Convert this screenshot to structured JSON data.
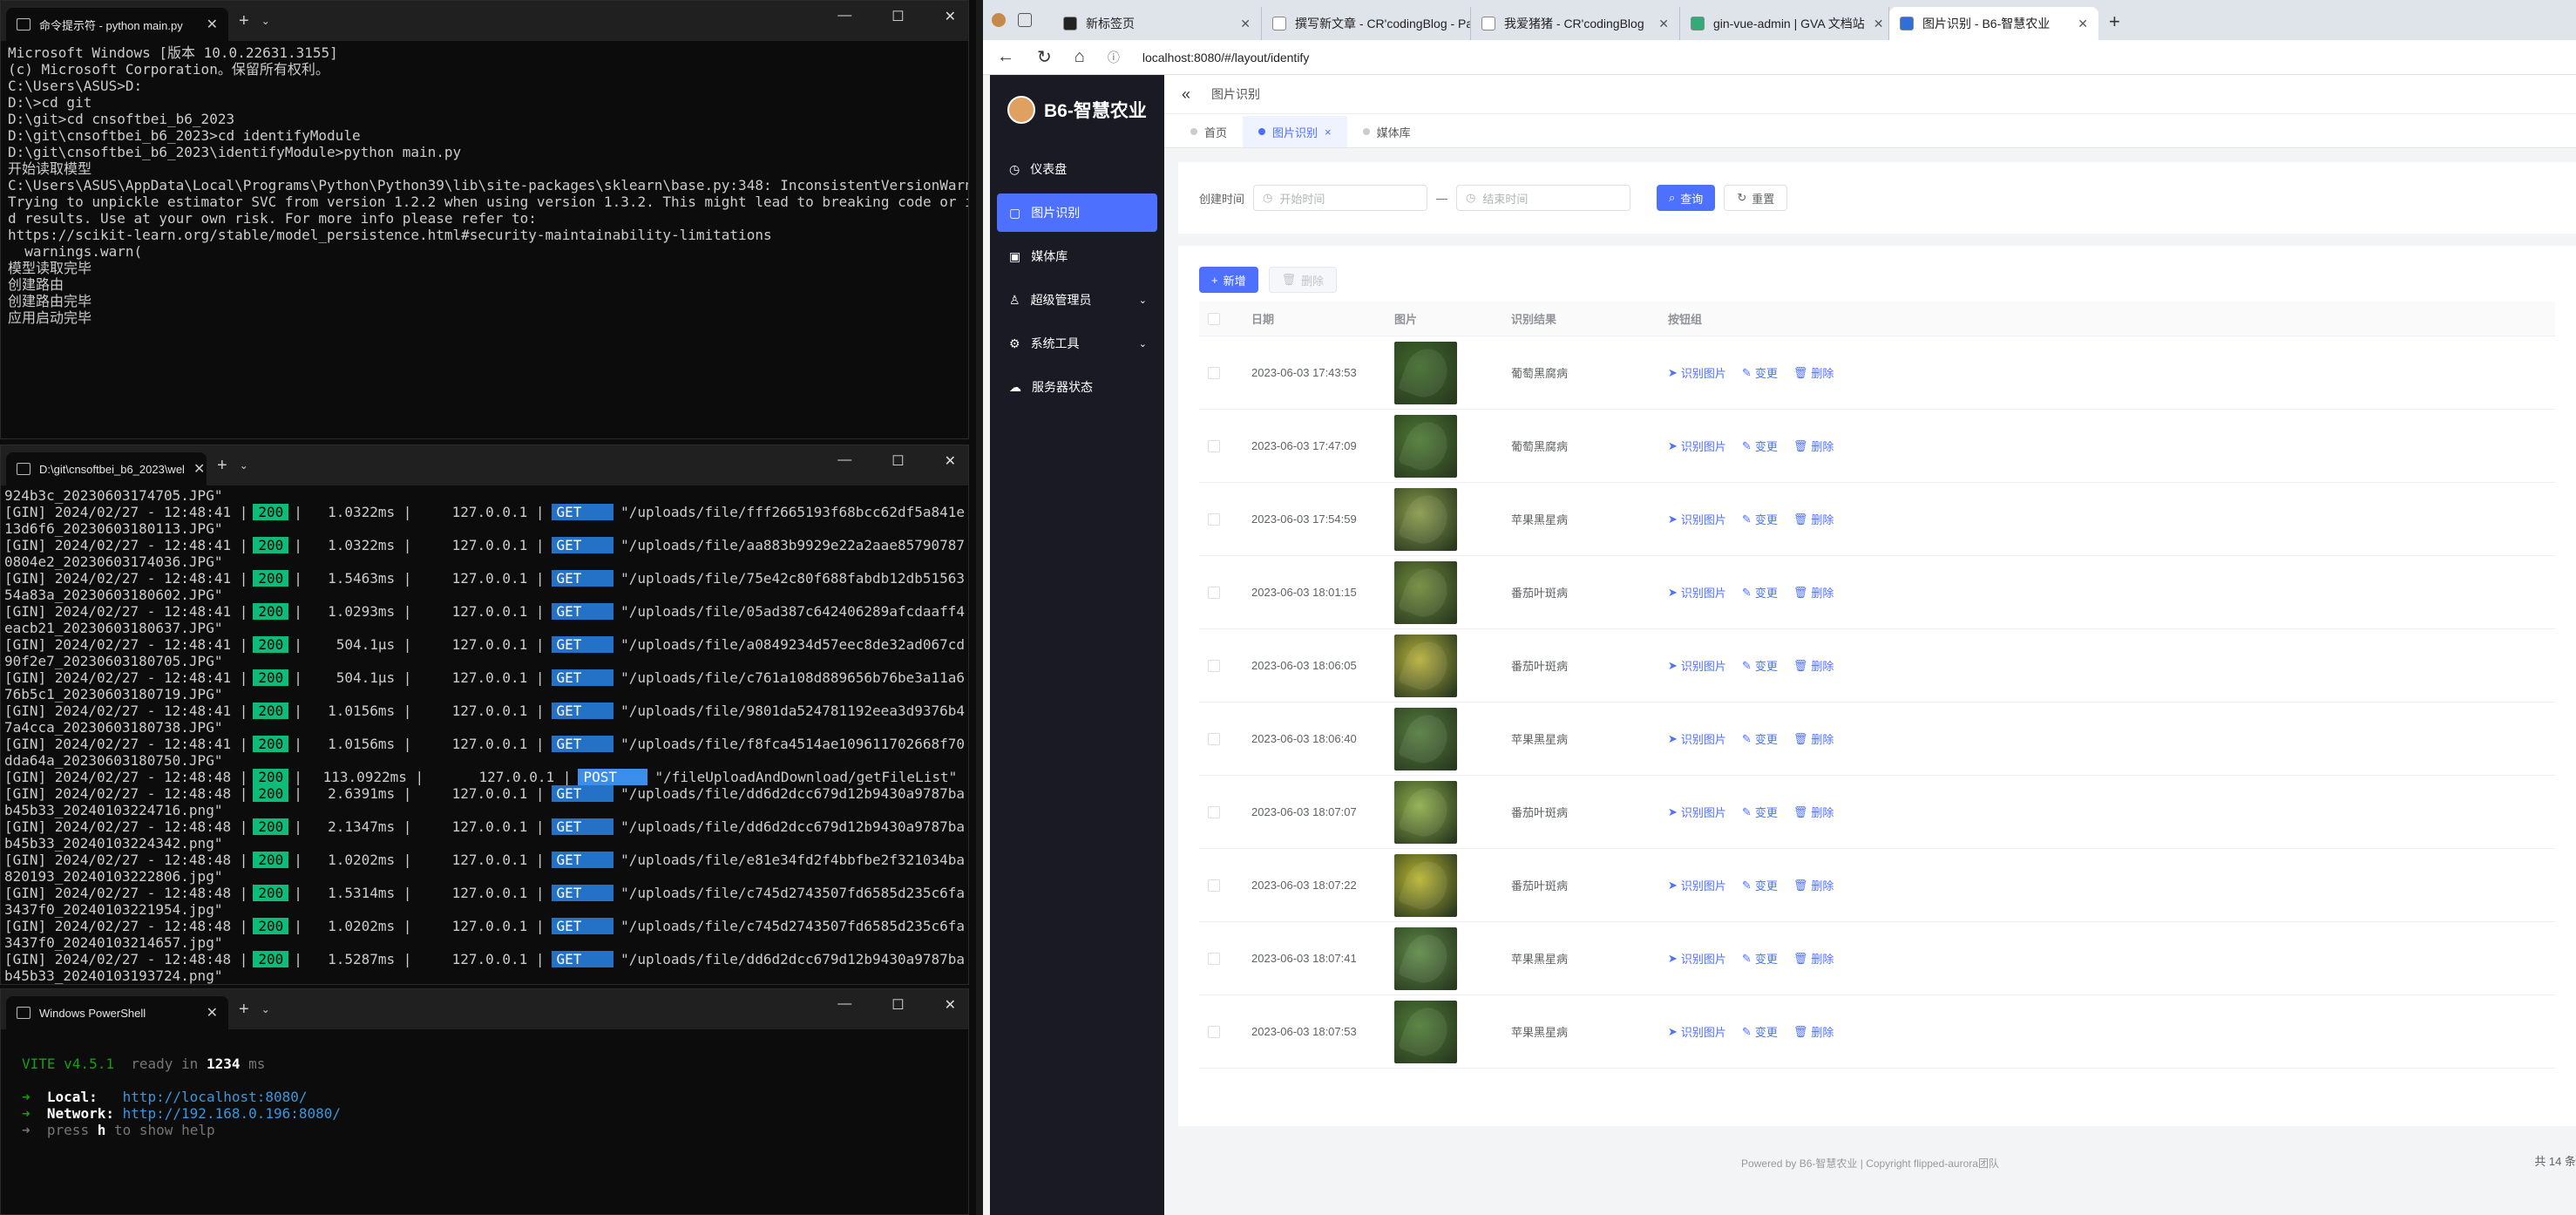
{
  "cmd": {
    "title": "命令提示符 - python  main.py",
    "lines": [
      "Microsoft Windows [版本 10.0.22631.3155]",
      "(c) Microsoft Corporation。保留所有权利。",
      "",
      "C:\\Users\\ASUS>D:",
      "",
      "D:\\>cd git",
      "",
      "D:\\git>cd cnsoftbei_b6_2023",
      "",
      "D:\\git\\cnsoftbei_b6_2023>cd identifyModule",
      "",
      "D:\\git\\cnsoftbei_b6_2023\\identifyModule>python main.py",
      "开始读取模型",
      "C:\\Users\\ASUS\\AppData\\Local\\Programs\\Python\\Python39\\lib\\site-packages\\sklearn\\base.py:348: InconsistentVersionWarning:",
      "Trying to unpickle estimator SVC from version 1.2.2 when using version 1.3.2. This might lead to breaking code or invali",
      "d results. Use at your own risk. For more info please refer to:",
      "https://scikit-learn.org/stable/model_persistence.html#security-maintainability-limitations",
      "  warnings.warn(",
      "模型读取完毕",
      "",
      "创建路由",
      "创建路由完毕",
      "",
      "应用启动完毕"
    ]
  },
  "gin": {
    "title": "D:\\git\\cnsoftbei_b6_2023\\wel",
    "first": "924b3c_20230603174705.JPG\"",
    "rows": [
      {
        "t": "2024/02/27 - 12:48:41",
        "ms": "1.0322ms",
        "m": "GET",
        "p": "\"/uploads/file/fff2665193f68bcc62df5a841e",
        "c": "13d6f6_20230603180113.JPG\""
      },
      {
        "t": "2024/02/27 - 12:48:41",
        "ms": "1.0322ms",
        "m": "GET",
        "p": "\"/uploads/file/aa883b9929e22a2aae85790787",
        "c": "0804e2_20230603174036.JPG\""
      },
      {
        "t": "2024/02/27 - 12:48:41",
        "ms": "1.5463ms",
        "m": "GET",
        "p": "\"/uploads/file/75e42c80f688fabdb12db51563",
        "c": "54a83a_20230603180602.JPG\""
      },
      {
        "t": "2024/02/27 - 12:48:41",
        "ms": "1.0293ms",
        "m": "GET",
        "p": "\"/uploads/file/05ad387c642406289afcdaaff4",
        "c": "eacb21_20230603180637.JPG\""
      },
      {
        "t": "2024/02/27 - 12:48:41",
        "ms": "504.1µs",
        "m": "GET",
        "p": "\"/uploads/file/a0849234d57eec8de32ad067cd",
        "c": "90f2e7_20230603180705.JPG\""
      },
      {
        "t": "2024/02/27 - 12:48:41",
        "ms": "504.1µs",
        "m": "GET",
        "p": "\"/uploads/file/c761a108d889656b76be3a11a6",
        "c": "76b5c1_20230603180719.JPG\""
      },
      {
        "t": "2024/02/27 - 12:48:41",
        "ms": "1.0156ms",
        "m": "GET",
        "p": "\"/uploads/file/9801da524781192eea3d9376b4",
        "c": "7a4cca_20230603180738.JPG\""
      },
      {
        "t": "2024/02/27 - 12:48:41",
        "ms": "1.0156ms",
        "m": "GET",
        "p": "\"/uploads/file/f8fca4514ae109611702668f70",
        "c": "dda64a_20230603180750.JPG\""
      },
      {
        "t": "2024/02/27 - 12:48:48",
        "ms": "113.0922ms",
        "m": "POST",
        "p": "\"/fileUploadAndDownload/getFileList\"",
        "c": null
      },
      {
        "t": "2024/02/27 - 12:48:48",
        "ms": "2.6391ms",
        "m": "GET",
        "p": "\"/uploads/file/dd6d2dcc679d12b9430a9787ba",
        "c": "b45b33_20240103224716.png\""
      },
      {
        "t": "2024/02/27 - 12:48:48",
        "ms": "2.1347ms",
        "m": "GET",
        "p": "\"/uploads/file/dd6d2dcc679d12b9430a9787ba",
        "c": "b45b33_20240103224342.png\""
      },
      {
        "t": "2024/02/27 - 12:48:48",
        "ms": "1.0202ms",
        "m": "GET",
        "p": "\"/uploads/file/e81e34fd2f4bbfbe2f321034ba",
        "c": "820193_20240103222806.jpg\""
      },
      {
        "t": "2024/02/27 - 12:48:48",
        "ms": "1.5314ms",
        "m": "GET",
        "p": "\"/uploads/file/c745d2743507fd6585d235c6fa",
        "c": "3437f0_20240103221954.jpg\""
      },
      {
        "t": "2024/02/27 - 12:48:48",
        "ms": "1.0202ms",
        "m": "GET",
        "p": "\"/uploads/file/c745d2743507fd6585d235c6fa",
        "c": "3437f0_20240103214657.jpg\""
      },
      {
        "t": "2024/02/27 - 12:48:48",
        "ms": "1.5287ms",
        "m": "GET",
        "p": "\"/uploads/file/dd6d2dcc679d12b9430a9787ba",
        "c": "b45b33_20240103193724.png\""
      }
    ],
    "status": "200",
    "ip": "127.0.0.1"
  },
  "ps": {
    "title": "Windows PowerShell",
    "vite": "VITE v4.5.1",
    "ready": "ready in",
    "ms": "1234",
    "msu": "ms",
    "local_label": "Local:",
    "local": "http://localhost:8080/",
    "net_label": "Network:",
    "net": "http://192.168.0.196:8080/",
    "help1": "press",
    "help_key": "h",
    "help2": "to show help"
  },
  "browser": {
    "tabs": [
      "新标签页",
      "撰写新文章 - CR'codingBlog - Pa",
      "我爱猪猪 - CR'codingBlog",
      "gin-vue-admin | GVA 文档站",
      "图片识别 - B6-智慧农业"
    ],
    "url": "localhost:8080/#/layout/identify"
  },
  "app": {
    "brand": "B6-智慧农业",
    "menu": [
      "仪表盘",
      "图片识别",
      "媒体库",
      "超级管理员",
      "系统工具",
      "服务器状态"
    ],
    "crumb": "图片识别",
    "page_tabs": [
      "首页",
      "图片识别",
      "媒体库"
    ],
    "search": {
      "label": "创建时间",
      "start": "开始时间",
      "end": "结束时间",
      "sep": "—",
      "query": "查询",
      "reset": "重置"
    },
    "add": "新增",
    "del": "删除",
    "headers": [
      "日期",
      "图片",
      "识别结果",
      "按钮组"
    ],
    "rows": [
      {
        "date": "2023-06-03 17:43:53",
        "result": "葡萄黑腐病"
      },
      {
        "date": "2023-06-03 17:47:09",
        "result": "葡萄黑腐病"
      },
      {
        "date": "2023-06-03 17:54:59",
        "result": "苹果黑星病"
      },
      {
        "date": "2023-06-03 18:01:15",
        "result": "番茄叶斑病"
      },
      {
        "date": "2023-06-03 18:06:05",
        "result": "番茄叶斑病"
      },
      {
        "date": "2023-06-03 18:06:40",
        "result": "苹果黑星病"
      },
      {
        "date": "2023-06-03 18:07:07",
        "result": "番茄叶斑病"
      },
      {
        "date": "2023-06-03 18:07:22",
        "result": "番茄叶斑病"
      },
      {
        "date": "2023-06-03 18:07:41",
        "result": "苹果黑星病"
      },
      {
        "date": "2023-06-03 18:07:53",
        "result": "苹果黑星病"
      }
    ],
    "ops": [
      "识别图片",
      "变更",
      "删除"
    ],
    "total": "共 14 条",
    "footer": "Powered by  B6-智慧农业    |    Copyright  flipped-aurora团队"
  },
  "colors": {
    "accent": "#4d70ff",
    "sidebar": "#191a24",
    "status200": "#0dbc79"
  }
}
